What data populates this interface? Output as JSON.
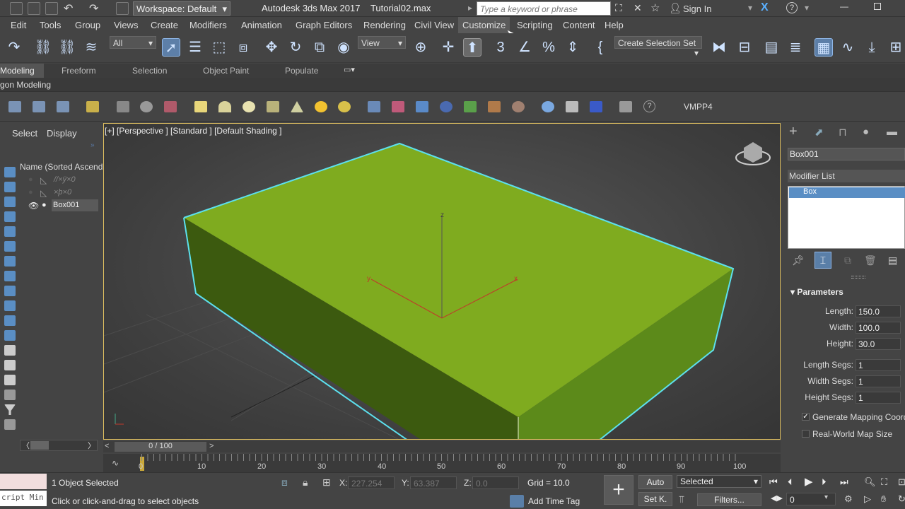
{
  "titlebar": {
    "workspace": "Workspace: Default",
    "app_title": "Autodesk 3ds Max 2017",
    "file_name": "Tutorial02.max",
    "search_placeholder": "Type a keyword or phrase",
    "sign_in": "Sign In"
  },
  "menus": [
    "Edit",
    "Tools",
    "Group",
    "Views",
    "Create",
    "Modifiers",
    "Animation",
    "Graph Editors",
    "Rendering",
    "Civil View",
    "Customize",
    "Scripting",
    "Content",
    "Help"
  ],
  "toolbar": {
    "filter": "All",
    "refcoord": "View",
    "selection_set": "Create Selection Set"
  },
  "ribbon": {
    "tabs": [
      "Modeling",
      "Freeform",
      "Selection",
      "Object Paint",
      "Populate"
    ],
    "sub": "gon Modeling"
  },
  "objbar": {
    "label": "VMPP4"
  },
  "scene_explorer": {
    "tabs": [
      "Select",
      "Display"
    ],
    "header": "Name (Sorted Ascend",
    "items": [
      "//×ÿ×0",
      "×þ×0",
      "Box001"
    ]
  },
  "viewport": {
    "label": "[+] [Perspective ] [Standard ] [Default Shading ]",
    "axis_z": "z",
    "axis_x": "x",
    "axis_y": "y",
    "box_color": "#7fab1f",
    "edge_color": "#5ce0ee"
  },
  "command_panel": {
    "object_name": "Box001",
    "modifier_list": "Modifier List",
    "modifier": "Box",
    "rollout": "Parameters",
    "params": [
      {
        "label": "Length:",
        "value": "150.0"
      },
      {
        "label": "Width:",
        "value": "100.0"
      },
      {
        "label": "Height:",
        "value": "30.0"
      },
      {
        "label": "Length Segs:",
        "value": "1"
      },
      {
        "label": "Width Segs:",
        "value": "1"
      },
      {
        "label": "Height Segs:",
        "value": "1"
      }
    ],
    "gen_mapping": "Generate Mapping Coords.",
    "real_world": "Real-World Map Size"
  },
  "timeline": {
    "frame": "0 / 100",
    "ticks": [
      "0",
      "10",
      "20",
      "30",
      "40",
      "50",
      "60",
      "70",
      "80",
      "90",
      "100"
    ]
  },
  "status": {
    "maxscript": "cript Min",
    "selected": "1 Object Selected",
    "prompt": "Click or click-and-drag to select objects",
    "x_label": "X:",
    "x_val": "227.254",
    "y_label": "Y:",
    "y_val": "63.387",
    "z_label": "Z:",
    "z_val": "0.0",
    "grid": "Grid = 10.0",
    "add_time_tag": "Add Time Tag",
    "auto": "Auto",
    "setk": "Set K.",
    "key_mode": "Selected",
    "filters": "Filters...",
    "frame_num": "0"
  }
}
